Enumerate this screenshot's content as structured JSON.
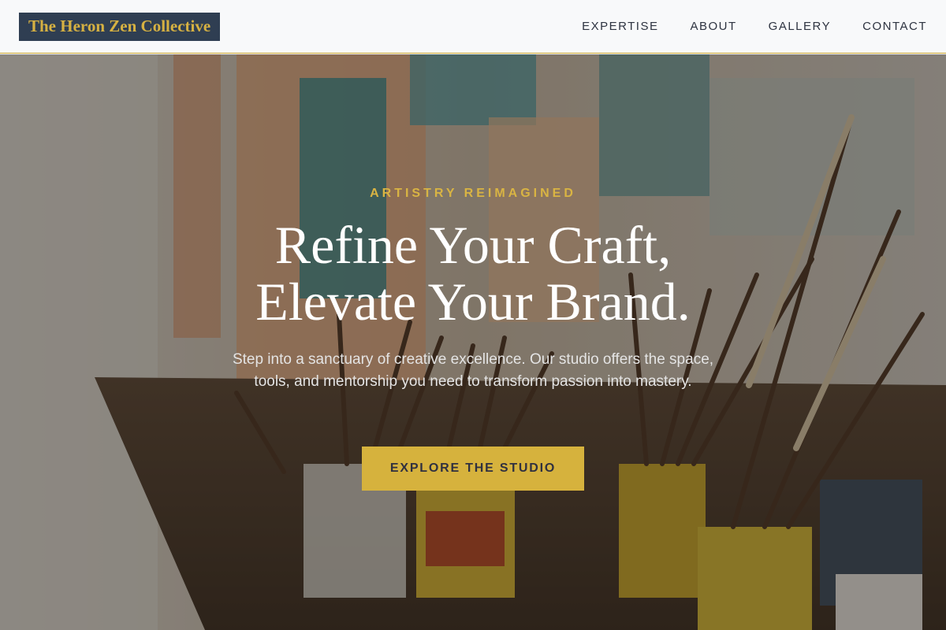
{
  "brand": {
    "name": "The Heron Zen Collective"
  },
  "nav": {
    "items": [
      "EXPERTISE",
      "ABOUT",
      "GALLERY",
      "CONTACT"
    ]
  },
  "hero": {
    "eyebrow": "ARTISTRY REIMAGINED",
    "headline_line1": "Refine Your Craft,",
    "headline_line2": "Elevate Your Brand.",
    "subtext": "Step into a sanctuary of creative excellence. Our studio offers the space, tools, and mentorship you need to transform passion into mastery.",
    "cta_label": "EXPLORE THE STUDIO"
  },
  "colors": {
    "accent": "#d6b23d",
    "logo_bg": "#2f3e52",
    "nav_text": "#2d3340"
  }
}
